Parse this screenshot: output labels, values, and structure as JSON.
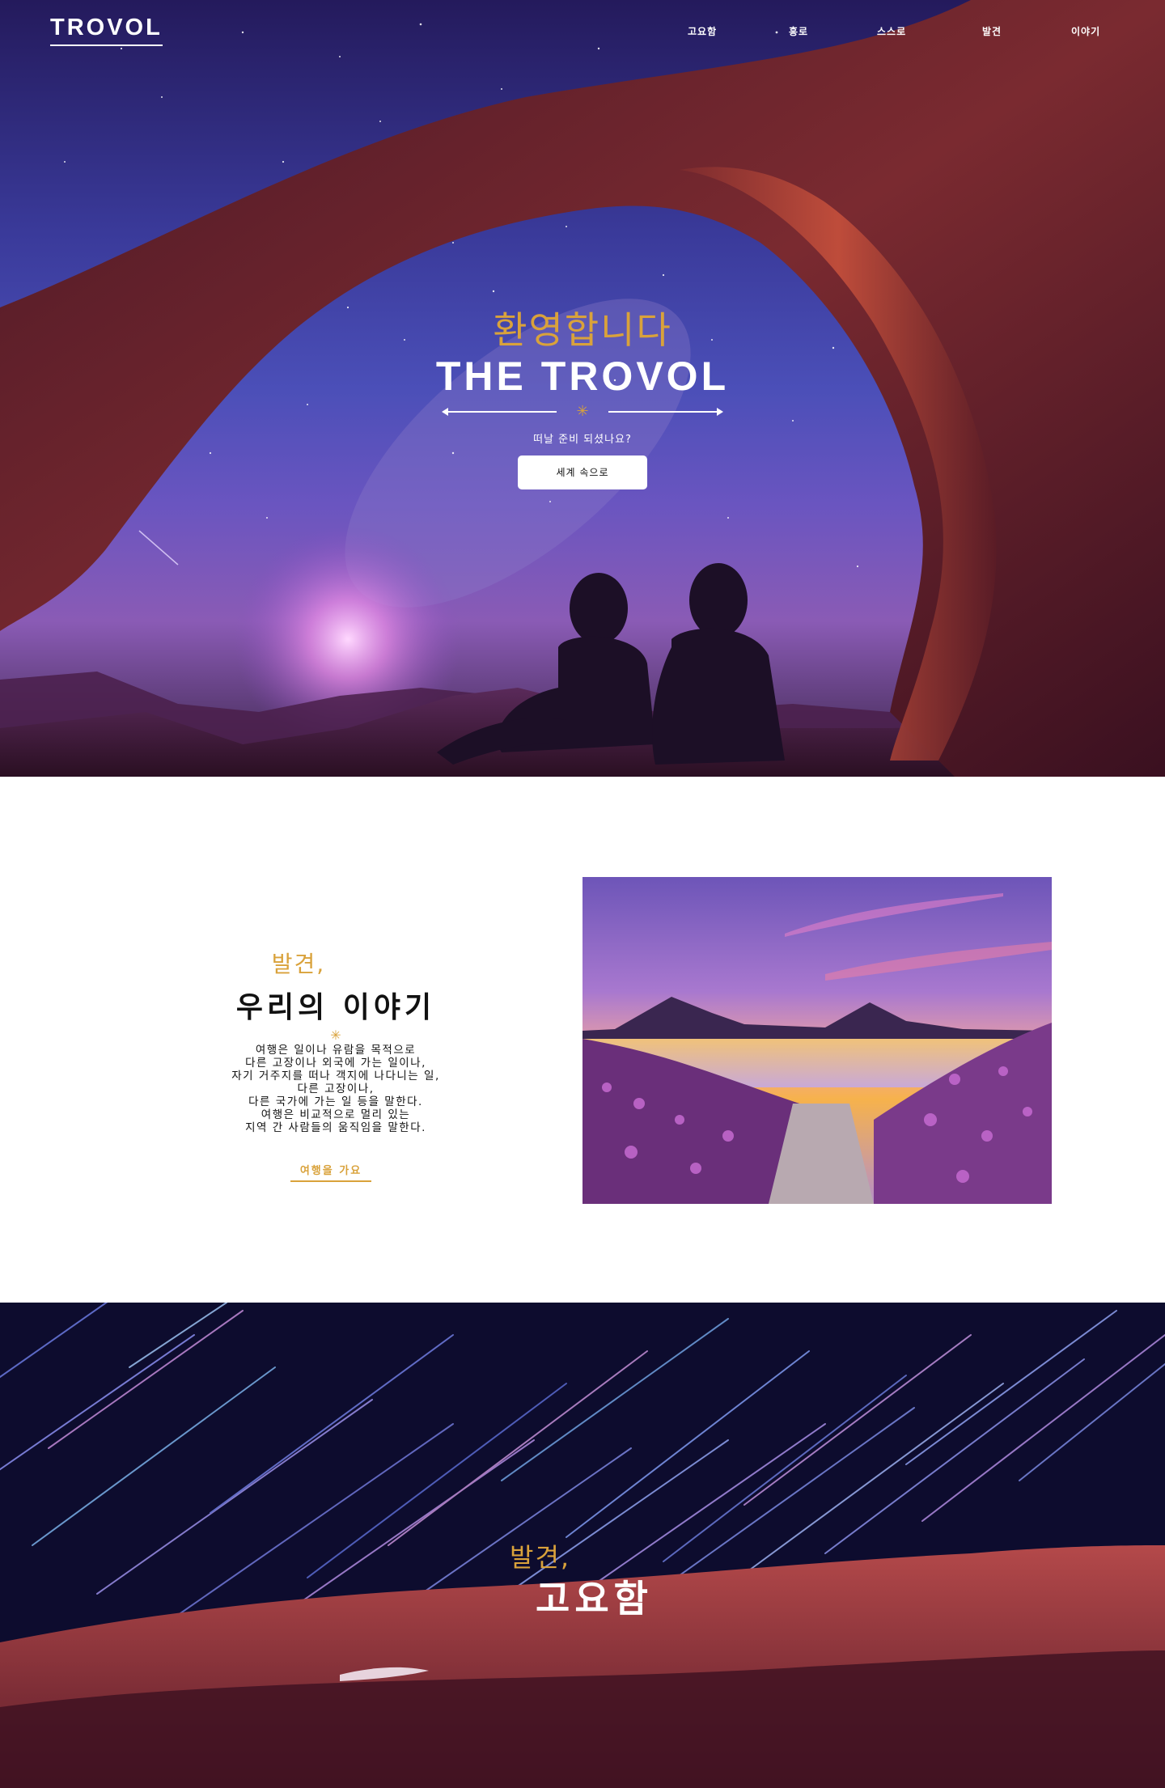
{
  "brand": {
    "logo": "TROVOL"
  },
  "nav": {
    "items": [
      "고요함",
      "흥로",
      "스스로",
      "발견",
      "이야기"
    ]
  },
  "hero": {
    "welcome": "환영합니다",
    "title": "THE TROVOL",
    "subtitle": "떠날 준비 되셨나요?",
    "cta": "세계 속으로"
  },
  "story": {
    "eyebrow": "발견,",
    "title": "우리의 이야기",
    "body": [
      "여행은 일이나 유람을 목적으로",
      "다른 고장이나 외국에 가는 일이나,",
      "자기 거주지를 떠나 객지에 나다니는 일,",
      "다른 고장이나,",
      "다른 국가에 가는 일 등을 말한다.",
      "여행은 비교적으로 멀리 있는",
      "지역 간 사람들의 움직임을 말한다."
    ],
    "link": "여행을 가요"
  },
  "trails": {
    "eyebrow": "발견,",
    "title": "고요함"
  },
  "colors": {
    "accent": "#d9a23b",
    "text": "#111111",
    "white": "#ffffff"
  },
  "icons": {
    "divider": "sparkle-icon"
  }
}
